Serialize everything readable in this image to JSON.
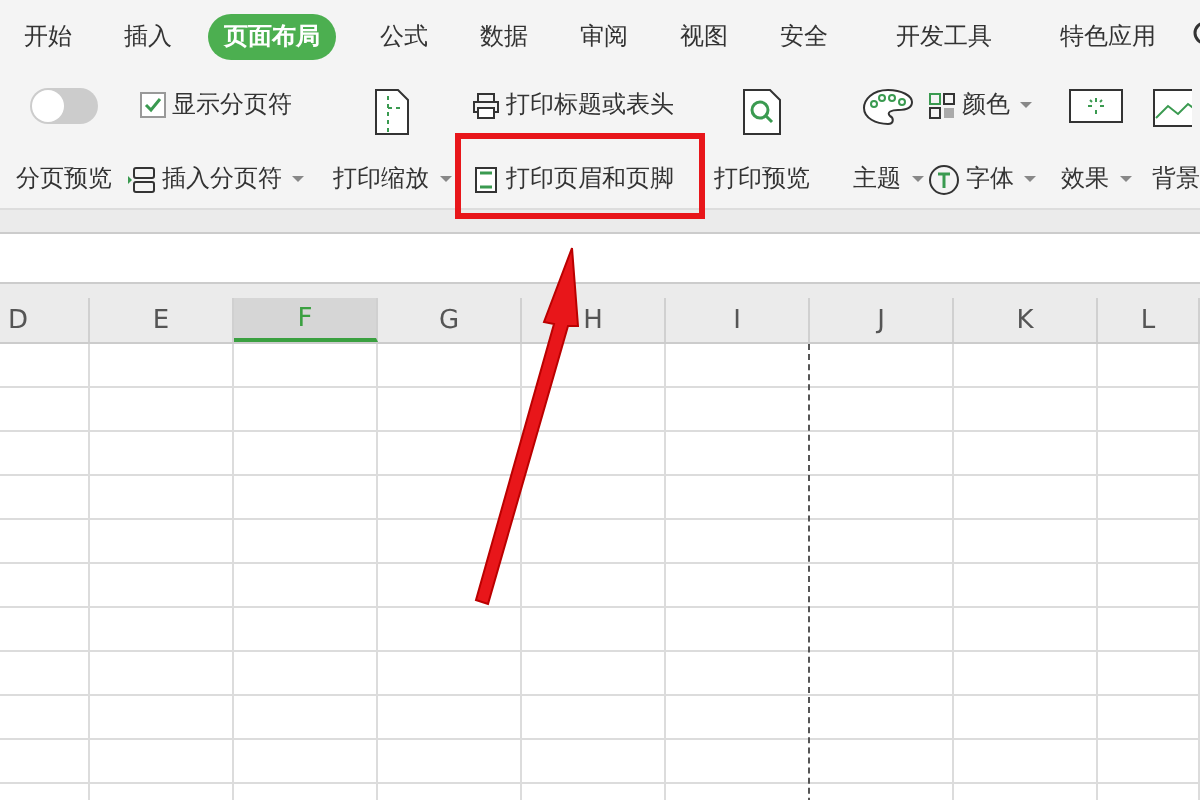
{
  "tabs": [
    {
      "label": "开始",
      "selected": false
    },
    {
      "label": "插入",
      "selected": false
    },
    {
      "label": "页面布局",
      "selected": true
    },
    {
      "label": "公式",
      "selected": false
    },
    {
      "label": "数据",
      "selected": false
    },
    {
      "label": "审阅",
      "selected": false
    },
    {
      "label": "视图",
      "selected": false
    },
    {
      "label": "安全",
      "selected": false
    },
    {
      "label": "开发工具",
      "selected": false
    },
    {
      "label": "特色应用",
      "selected": false
    }
  ],
  "ribbon": {
    "page_break_preview": {
      "label": "分页预览",
      "on": false
    },
    "show_page_breaks": {
      "label": "显示分页符",
      "checked": true
    },
    "insert_page_break": {
      "label": "插入分页符"
    },
    "print_scaling": {
      "label": "打印缩放"
    },
    "print_titles": {
      "label": "打印标题或表头"
    },
    "print_header_footer": {
      "label": "打印页眉和页脚"
    },
    "print_preview": {
      "label": "打印预览"
    },
    "theme": {
      "label": "主题"
    },
    "colors": {
      "label": "颜色"
    },
    "fonts": {
      "label": "字体"
    },
    "effects": {
      "label": "效果"
    },
    "background": {
      "label": "背景"
    }
  },
  "columns": [
    {
      "label": "D",
      "selected": false
    },
    {
      "label": "E",
      "selected": false
    },
    {
      "label": "F",
      "selected": true
    },
    {
      "label": "G",
      "selected": false
    },
    {
      "label": "H",
      "selected": false
    },
    {
      "label": "I",
      "selected": false
    },
    {
      "label": "J",
      "selected": false
    },
    {
      "label": "K",
      "selected": false
    },
    {
      "label": "L",
      "selected": false
    }
  ]
}
